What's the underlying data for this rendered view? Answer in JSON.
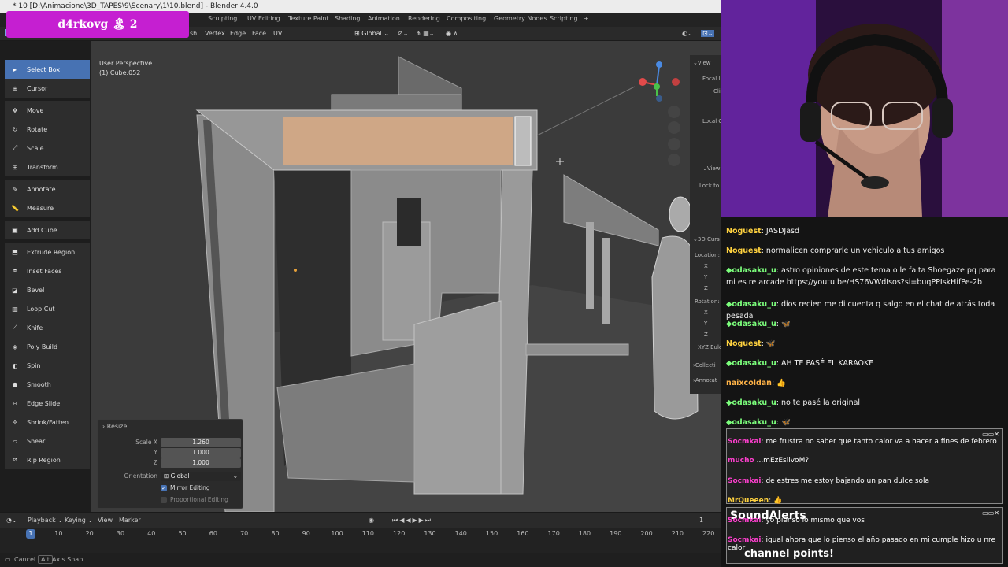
{
  "window": {
    "title": "* 10 [D:\\Animacione\\3D_TAPES\\9\\Scenary\\1\\10.blend] - Blender 4.4.0"
  },
  "streamer": {
    "name": "d4rkovg 🏝 2"
  },
  "workspaces": [
    "Sculpting",
    "UV Editing",
    "Texture Paint",
    "Shading",
    "Animation",
    "Rendering",
    "Compositing",
    "Geometry Nodes",
    "Scripting",
    "+"
  ],
  "header": {
    "menus": [
      "sh",
      "Vertex",
      "Edge",
      "Face",
      "UV"
    ],
    "orientation": "Global"
  },
  "viewport": {
    "perspective": "User Perspective",
    "object": "(1) Cube.052"
  },
  "toolbar": {
    "tools": [
      {
        "label": "Select Box",
        "icon": "select-box-icon",
        "active": true
      },
      {
        "label": "Cursor",
        "icon": "cursor-icon"
      },
      {
        "label": "Move",
        "icon": "move-icon"
      },
      {
        "label": "Rotate",
        "icon": "rotate-icon"
      },
      {
        "label": "Scale",
        "icon": "scale-icon"
      },
      {
        "label": "Transform",
        "icon": "transform-icon"
      },
      {
        "label": "Annotate",
        "icon": "annotate-icon"
      },
      {
        "label": "Measure",
        "icon": "measure-icon"
      },
      {
        "label": "Add Cube",
        "icon": "add-cube-icon"
      },
      {
        "label": "Extrude Region",
        "icon": "extrude-icon"
      },
      {
        "label": "Inset Faces",
        "icon": "inset-icon"
      },
      {
        "label": "Bevel",
        "icon": "bevel-icon"
      },
      {
        "label": "Loop Cut",
        "icon": "loop-cut-icon"
      },
      {
        "label": "Knife",
        "icon": "knife-icon"
      },
      {
        "label": "Poly Build",
        "icon": "poly-build-icon"
      },
      {
        "label": "Spin",
        "icon": "spin-icon"
      },
      {
        "label": "Smooth",
        "icon": "smooth-icon"
      },
      {
        "label": "Edge Slide",
        "icon": "edge-slide-icon"
      },
      {
        "label": "Shrink/Fatten",
        "icon": "shrink-fatten-icon"
      },
      {
        "label": "Shear",
        "icon": "shear-icon"
      },
      {
        "label": "Rip Region",
        "icon": "rip-icon"
      }
    ]
  },
  "resize_panel": {
    "title": "Resize",
    "scale_x_label": "Scale X",
    "scale_x": "1.260",
    "y_label": "Y",
    "y": "1.000",
    "z_label": "Z",
    "z": "1.000",
    "orientation_label": "Orientation",
    "orientation": "Global",
    "mirror_editing": "Mirror Editing",
    "proportional_editing": "Proportional Editing"
  },
  "properties": {
    "view": "View",
    "focal": "Focal l",
    "clip": "Cli",
    "local": "Local C",
    "view2": "View",
    "lock": "Lock to",
    "cursor": "3D Curs",
    "location": "Location:",
    "x": "X",
    "y": "Y",
    "z": "Z",
    "rotation": "Rotation:",
    "rx": "X",
    "ry": "Y",
    "rz": "Z",
    "euler": "XYZ Eule",
    "collection": "Collecti",
    "annotations": "Annotat"
  },
  "timeline": {
    "menus": [
      "Playback",
      "Keying",
      "View",
      "Marker"
    ],
    "current_frame": "1",
    "ticks": [
      "1",
      "10",
      "20",
      "30",
      "40",
      "50",
      "60",
      "70",
      "80",
      "90",
      "100",
      "110",
      "120",
      "130",
      "140",
      "150",
      "160",
      "170",
      "180",
      "190",
      "200",
      "210",
      "220"
    ]
  },
  "statusbar": {
    "cancel": "Cancel",
    "alt_key": "Alt",
    "axis_snap": "Axis Snap"
  },
  "chat": {
    "messages": [
      {
        "user": "Noguest",
        "color": "#ffd23f",
        "text": "JASDJasd"
      },
      {
        "user": "Noguest",
        "color": "#ffd23f",
        "text": "normalicen comprarle un vehiculo a tus amigos"
      },
      {
        "user": "odasaku_u",
        "color": "#7cff7c",
        "text": "astro opiniones de este tema o le falta Shoegaze pq para mi es re arcade https://youtu.be/HS76VWdIsos?si=buqPPIskHifPe-2b"
      },
      {
        "user": "odasaku_u",
        "color": "#7cff7c",
        "text": "dios recien me di cuenta q salgo en el chat de atrás toda pesada"
      },
      {
        "user": "odasaku_u",
        "color": "#7cff7c",
        "text": "🦋"
      },
      {
        "user": "Noguest",
        "color": "#ffd23f",
        "text": "🦋"
      },
      {
        "user": "odasaku_u",
        "color": "#7cff7c",
        "text": "AH TE PASÉ EL KARAOKE"
      },
      {
        "user": "naixcoldan",
        "color": "#ffb347",
        "text": "👍"
      },
      {
        "user": "odasaku_u",
        "color": "#7cff7c",
        "text": "no te pasé la original"
      },
      {
        "user": "odasaku_u",
        "color": "#7cff7c",
        "text": "🦋"
      }
    ],
    "overlay": [
      {
        "user": "Socmkai",
        "text": "me frustra no saber que tanto calor va a hacer a fines de febrero"
      },
      {
        "user": "mucho",
        "text": "...mEzEslivoM?"
      },
      {
        "user": "Socmkai",
        "text": "de estres me estoy bajando un pan dulce sola"
      },
      {
        "user": "MrQueeen",
        "text": "👍"
      },
      {
        "user": "Socmkai",
        "text": "yo pienso lo mismo que vos"
      },
      {
        "user": "Socmkai",
        "text": "igual ahora que lo pienso el año pasado en mi cumple hizo u nre calor"
      }
    ],
    "sound_alerts": "SoundAlerts",
    "channel_points": "channel points!"
  }
}
